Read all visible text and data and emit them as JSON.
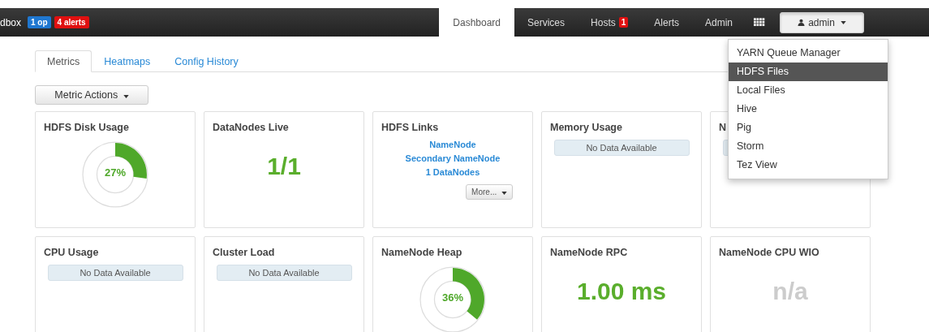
{
  "navbar": {
    "brand": "dbox",
    "ops_badge": "1 op",
    "alerts_badge": "4 alerts",
    "items": [
      {
        "label": "Dashboard",
        "selected": true
      },
      {
        "label": "Services",
        "selected": false
      },
      {
        "label": "Hosts",
        "badge": "1",
        "selected": false
      },
      {
        "label": "Alerts",
        "selected": false
      },
      {
        "label": "Admin",
        "selected": false
      }
    ],
    "user_menu": {
      "label": "admin",
      "expanded": true,
      "items": [
        {
          "label": "YARN Queue Manager",
          "selected": false
        },
        {
          "label": "HDFS Files",
          "selected": true
        },
        {
          "label": "Local Files",
          "selected": false
        },
        {
          "label": "Hive",
          "selected": false
        },
        {
          "label": "Pig",
          "selected": false
        },
        {
          "label": "Storm",
          "selected": false
        },
        {
          "label": "Tez View",
          "selected": false
        }
      ]
    }
  },
  "tabs": [
    {
      "label": "Metrics",
      "selected": true
    },
    {
      "label": "Heatmaps",
      "selected": false
    },
    {
      "label": "Config History",
      "selected": false
    }
  ],
  "metric_actions": "Metric Actions",
  "widgets": [
    {
      "title": "HDFS Disk Usage",
      "kind": "donut",
      "value": "27%"
    },
    {
      "title": "DataNodes Live",
      "kind": "value",
      "value": "1/1",
      "muted": false
    },
    {
      "title": "HDFS Links",
      "kind": "links",
      "links": [
        "NameNode",
        "Secondary NameNode",
        "1 DataNodes"
      ],
      "more": "More..."
    },
    {
      "title": "Memory Usage",
      "kind": "nodata",
      "message": "No Data Available"
    },
    {
      "title": "N",
      "kind": "blank"
    },
    {
      "title": "CPU Usage",
      "kind": "nodata",
      "message": "No Data Available"
    },
    {
      "title": "Cluster Load",
      "kind": "nodata",
      "message": "No Data Available"
    },
    {
      "title": "NameNode Heap",
      "kind": "donut",
      "value": "36%"
    },
    {
      "title": "NameNode RPC",
      "kind": "value",
      "value": "1.00 ms",
      "muted": false
    },
    {
      "title": "NameNode CPU WIO",
      "kind": "value",
      "value": "n/a",
      "muted": true
    }
  ]
}
